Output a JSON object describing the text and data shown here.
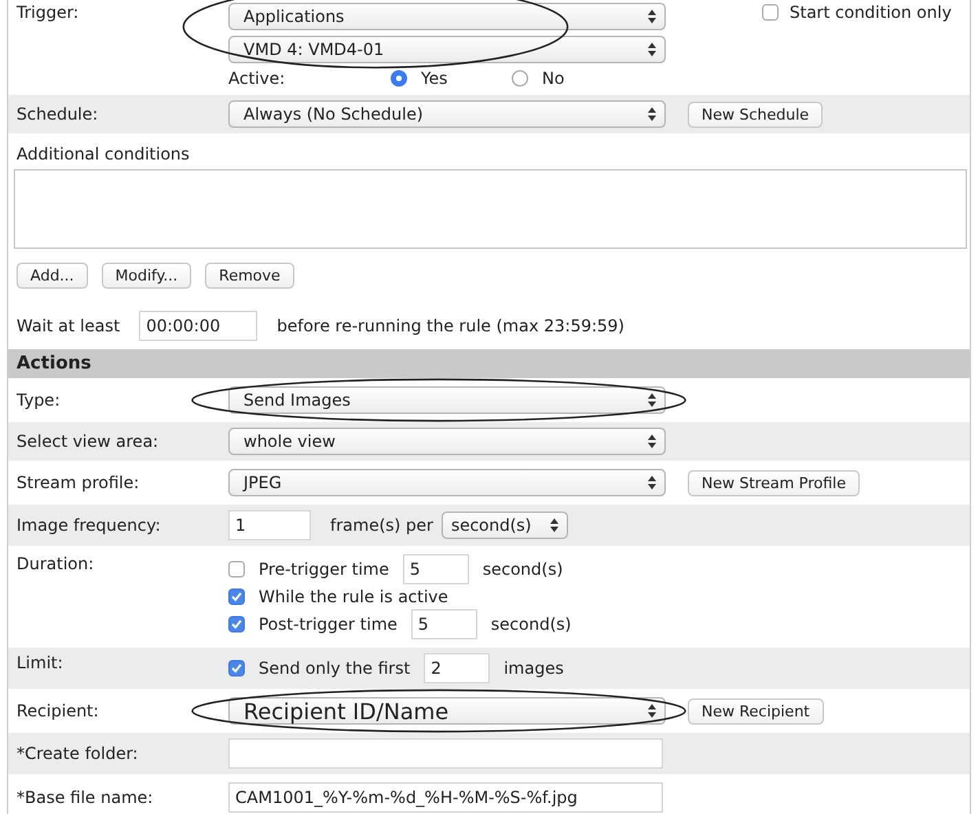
{
  "trigger": {
    "label": "Trigger:",
    "selects": [
      "Applications",
      "VMD 4: VMD4-01"
    ],
    "circled": true,
    "start_condition": {
      "label": "Start condition only",
      "checked": false
    },
    "active": {
      "label": "Active:",
      "options": [
        {
          "label": "Yes",
          "selected": true
        },
        {
          "label": "No",
          "selected": false
        }
      ]
    }
  },
  "schedule": {
    "label": "Schedule:",
    "value": "Always (No Schedule)",
    "button": "New Schedule"
  },
  "additional_conditions": {
    "label": "Additional conditions",
    "buttons": [
      "Add...",
      "Modify...",
      "Remove"
    ]
  },
  "wait": {
    "label": "Wait at least",
    "value": "00:00:00",
    "suffix": "before re-running the rule (max 23:59:59)"
  },
  "actions": {
    "heading": "Actions",
    "rows": [
      {
        "kind": "select",
        "label": "Type:",
        "value": "Send Images",
        "circled": true
      },
      {
        "kind": "select",
        "label": "Select view area:",
        "value": "whole view"
      },
      {
        "kind": "select",
        "label": "Stream profile:",
        "value": "JPEG",
        "button": "New Stream Profile"
      },
      {
        "kind": "frequency",
        "label": "Image frequency:",
        "value": "1",
        "text": "frame(s) per",
        "unit": "second(s)"
      },
      {
        "kind": "checks",
        "label": "Duration:",
        "items": [
          {
            "checked": false,
            "label": "Pre-trigger time",
            "value": "5",
            "unit": "second(s)"
          },
          {
            "checked": true,
            "label": "While the rule is active"
          },
          {
            "checked": true,
            "label": "Post-trigger time",
            "value": "5",
            "unit": "second(s)"
          }
        ]
      },
      {
        "kind": "checks",
        "label": "Limit:",
        "items": [
          {
            "checked": true,
            "label": "Send only the first",
            "value": "2",
            "unit": "images"
          }
        ]
      },
      {
        "kind": "select",
        "label": "Recipient:",
        "value": "Recipient ID/Name",
        "button": "New Recipient",
        "circled": true,
        "large": true
      },
      {
        "kind": "input",
        "label": "*Create folder:"
      },
      {
        "kind": "input",
        "label": "*Base file name:",
        "value": "CAM1001_%Y-%m-%d_%H-%M-%S-%f.jpg"
      }
    ]
  }
}
